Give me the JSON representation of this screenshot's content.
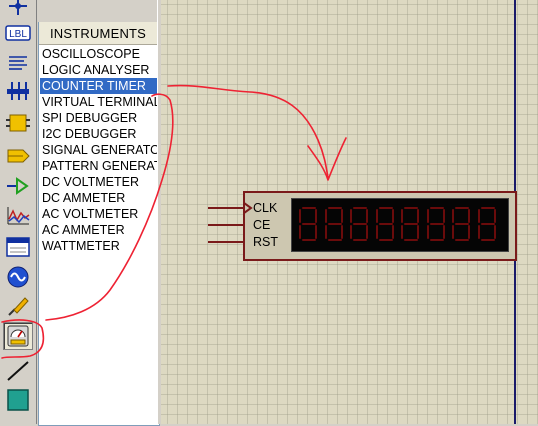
{
  "toolbar": {
    "items": [
      {
        "icon": "junction-icon"
      },
      {
        "icon": "label-icon",
        "text": "LBL"
      },
      {
        "icon": "text-script-icon"
      },
      {
        "icon": "bus-icon"
      },
      {
        "icon": "subcircuit-icon"
      },
      {
        "icon": "terminal-icon"
      },
      {
        "icon": "device-pin-icon"
      },
      {
        "icon": "graph-icon"
      },
      {
        "icon": "tape-recorder-icon"
      },
      {
        "icon": "generator-icon"
      },
      {
        "icon": "voltage-probe-icon"
      },
      {
        "icon": "virtual-instruments-icon"
      },
      {
        "icon": "line-tool-icon"
      },
      {
        "icon": "box-tool-icon"
      }
    ]
  },
  "panel": {
    "title": "INSTRUMENTS",
    "items": [
      "OSCILLOSCOPE",
      "LOGIC ANALYSER",
      "COUNTER TIMER",
      "VIRTUAL TERMINAL",
      "SPI DEBUGGER",
      "I2C DEBUGGER",
      "SIGNAL GENERATOR",
      "PATTERN GENERATOR",
      "DC VOLTMETER",
      "DC AMMETER",
      "AC VOLTMETER",
      "AC AMMETER",
      "WATTMETER"
    ],
    "selected_index": 2
  },
  "component": {
    "pins": [
      "CLK",
      "CE",
      "RST"
    ],
    "digit_count": 8
  },
  "colors": {
    "selection": "#316ac5",
    "component_border": "#7a1a1a",
    "segment": "#6a0b0b",
    "annotation": "#ee2233"
  }
}
